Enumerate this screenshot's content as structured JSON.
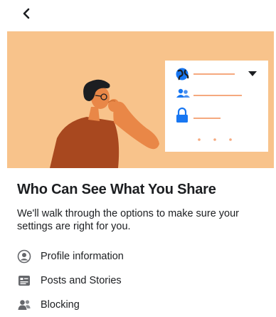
{
  "nav": {
    "back_icon": "chevron-left-icon"
  },
  "hero": {
    "background": "#f8c38b",
    "card_icons": [
      "globe-icon",
      "people-icon",
      "lock-icon"
    ],
    "dropdown_icon": "caret-down-icon"
  },
  "title": "Who Can See What You Share",
  "subtitle": "We'll walk through the options to make sure your settings are right for you.",
  "topics": [
    {
      "label": "Profile information",
      "icon": "profile-circle-icon"
    },
    {
      "label": "Posts and Stories",
      "icon": "posts-icon"
    },
    {
      "label": "Blocking",
      "icon": "blocking-people-icon"
    }
  ]
}
